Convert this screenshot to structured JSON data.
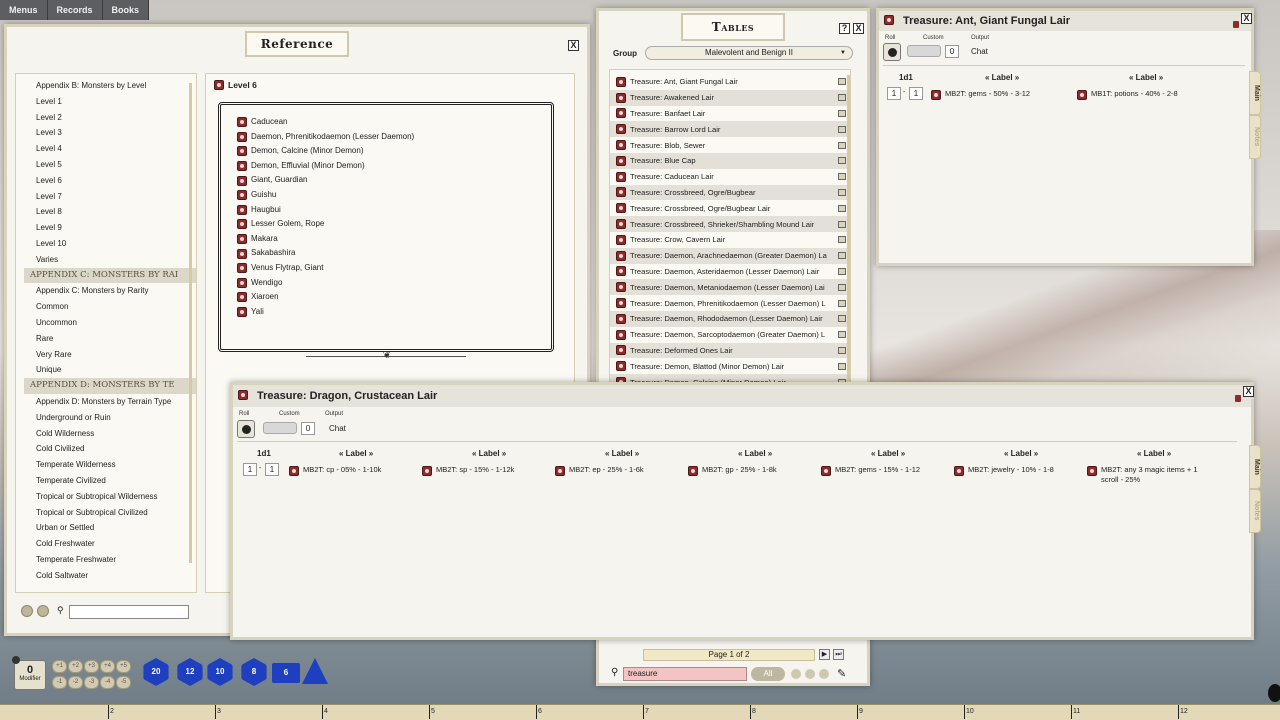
{
  "topbar": {
    "items": [
      "Menus",
      "Records",
      "Books"
    ]
  },
  "reference": {
    "title": "Reference",
    "items": [
      {
        "t": "item",
        "label": "Appendix B: Monsters by Level"
      },
      {
        "t": "item",
        "label": "Level 1"
      },
      {
        "t": "item",
        "label": "Level 2"
      },
      {
        "t": "item",
        "label": "Level 3"
      },
      {
        "t": "item",
        "label": "Level 4"
      },
      {
        "t": "item",
        "label": "Level 5"
      },
      {
        "t": "item",
        "label": "Level 6"
      },
      {
        "t": "item",
        "label": "Level 7"
      },
      {
        "t": "item",
        "label": "Level 8"
      },
      {
        "t": "item",
        "label": "Level 9"
      },
      {
        "t": "item",
        "label": "Level 10"
      },
      {
        "t": "item",
        "label": "Varies"
      },
      {
        "t": "cat",
        "label": "Appendix C: Monsters by Rai"
      },
      {
        "t": "item",
        "label": "Appendix C: Monsters by Rarity"
      },
      {
        "t": "item",
        "label": "Common"
      },
      {
        "t": "item",
        "label": "Uncommon"
      },
      {
        "t": "item",
        "label": "Rare"
      },
      {
        "t": "item",
        "label": "Very Rare"
      },
      {
        "t": "item",
        "label": "Unique"
      },
      {
        "t": "cat",
        "label": "Appendix D: Monsters by Te"
      },
      {
        "t": "item",
        "label": "Appendix D: Monsters by Terrain Type"
      },
      {
        "t": "item",
        "label": "Underground or Ruin"
      },
      {
        "t": "item",
        "label": "Cold Wilderness"
      },
      {
        "t": "item",
        "label": "Cold Civilized"
      },
      {
        "t": "item",
        "label": "Temperate Wilderness"
      },
      {
        "t": "item",
        "label": "Temperate Civilized"
      },
      {
        "t": "item",
        "label": "Tropical or Subtropical Wilderness"
      },
      {
        "t": "item",
        "label": "Tropical or Subtropical Civilized"
      },
      {
        "t": "item",
        "label": "Urban or Settled"
      },
      {
        "t": "item",
        "label": "Cold Freshwater"
      },
      {
        "t": "item",
        "label": "Temperate Freshwater"
      },
      {
        "t": "item",
        "label": "Cold Saltwater"
      }
    ],
    "page_title": "Level 6",
    "monsters": [
      "Caducean",
      "Daemon, Phrenitikodaemon (Lesser Daemon)",
      "Demon, Calcine (Minor Demon)",
      "Demon, Effluvial (Minor Demon)",
      "Giant, Guardian",
      "Guishu",
      "Haugbui",
      "Lesser Golem, Rope",
      "Makara",
      "Sakabashira",
      "Venus Flytrap, Giant",
      "Wendigo",
      "Xiaroen",
      "Yali"
    ]
  },
  "tables": {
    "title": "Tables",
    "help": "?",
    "close": "X",
    "group_label": "Group",
    "group_value": "Malevolent and Benign II",
    "rows": [
      "Treasure: Ant, Giant Fungal Lair",
      "Treasure: Awakened Lair",
      "Treasure: Banfaet Lair",
      "Treasure: Barrow Lord Lair",
      "Treasure: Blob, Sewer",
      "Treasure: Blue Cap",
      "Treasure: Caducean Lair",
      "Treasure: Crossbreed, Ogre/Bugbear",
      "Treasure: Crossbreed, Ogre/Bugbear Lair",
      "Treasure: Crossbreed, Shrieker/Shambling Mound Lair",
      "Treasure: Crow, Cavern Lair",
      "Treasure: Daemon, Arachnedaemon (Greater Daemon) La",
      "Treasure: Daemon, Asteridaemon (Lesser Daemon) Lair",
      "Treasure: Daemon, Metaniodaemon (Lesser Daemon) Lai",
      "Treasure: Daemon, Phrenitikodaemon (Lesser Daemon) L",
      "Treasure: Daemon, Rhododaemon (Lesser Daemon) Lair",
      "Treasure: Daemon, Sarcoptodaemon (Greater Daemon) L",
      "Treasure: Deformed Ones Lair",
      "Treasure: Demon, Blattod (Minor Demon) Lair",
      "Treasure: Demon, Calcine (Minor Demon) Lair"
    ],
    "page_text": "Page 1 of 2",
    "search_value": "treasure",
    "all_label": "All"
  },
  "ant_window": {
    "title": "Treasure: Ant, Giant Fungal Lair",
    "roll_label": "Roll",
    "custom_label": "Custom",
    "output_label": "Output",
    "custom_value": "0",
    "output_value": "Chat",
    "dice": "1d1",
    "label_hdr": "« Label »",
    "range_from": "1",
    "range_to": "1",
    "results": [
      "MB2T: gems - 50% - 3-12",
      "MB1T: potions - 40% - 2-8"
    ],
    "tab_main": "Main",
    "tab_notes": "Notes",
    "close": "X"
  },
  "dragon_window": {
    "title": "Treasure: Dragon, Crustacean Lair",
    "roll_label": "Roll",
    "custom_label": "Custom",
    "output_label": "Output",
    "custom_value": "0",
    "output_value": "Chat",
    "dice": "1d1",
    "label_hdr": "« Label »",
    "range_from": "1",
    "range_to": "1",
    "results": [
      "MB2T: cp - 05% - 1-10k",
      "MB2T: sp - 15% - 1-12k",
      "MB2T: ep - 25% - 1-6k",
      "MB2T: gp - 25% - 1-8k",
      "MB2T: gems - 15% - 1-12",
      "MB2T: jewelry - 10% - 1-8",
      "MB2T: any 3 magic items + 1 scroll - 25%"
    ],
    "tab_main": "Main",
    "tab_notes": "Notes",
    "close": "X"
  },
  "modifier": {
    "value": "0",
    "label": "Modifier"
  },
  "mod_buttons": [
    "+1",
    "+2",
    "+3",
    "+4",
    "+5",
    "-1",
    "-2",
    "-3",
    "-4",
    "-5"
  ],
  "dice": [
    "d20",
    "d12",
    "d10",
    "d8",
    "d6",
    "d4"
  ],
  "dice_labels": [
    "20",
    "12",
    "10",
    "8",
    "6",
    ""
  ],
  "ruler": [
    "2",
    "3",
    "4",
    "5",
    "6",
    "7",
    "8",
    "9",
    "10",
    "11",
    "12"
  ],
  "colors": {
    "accent": "#8f2b2b",
    "dice_blue": "#1e3fbf",
    "panel": "#f6f4ee",
    "frame": "#d8d3bf"
  }
}
